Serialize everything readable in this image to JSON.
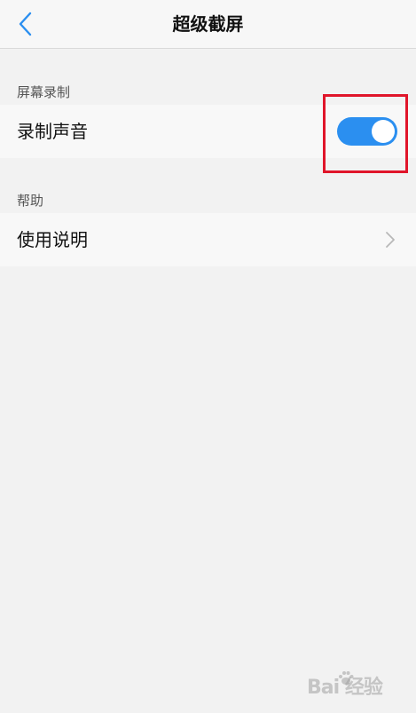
{
  "header": {
    "title": "超级截屏"
  },
  "sections": [
    {
      "label": "屏幕录制",
      "rows": [
        {
          "label": "录制声音",
          "control": "toggle",
          "toggle_on": true
        }
      ]
    },
    {
      "label": "帮助",
      "rows": [
        {
          "label": "使用说明",
          "control": "chevron"
        }
      ]
    }
  ],
  "colors": {
    "accent": "#2b8ff0",
    "highlight": "#e0152a",
    "background": "#f2f2f2"
  },
  "icons": {
    "back": "chevron-left-icon",
    "row_arrow": "chevron-right-icon"
  },
  "watermark": {
    "text": "Bai 经验"
  }
}
